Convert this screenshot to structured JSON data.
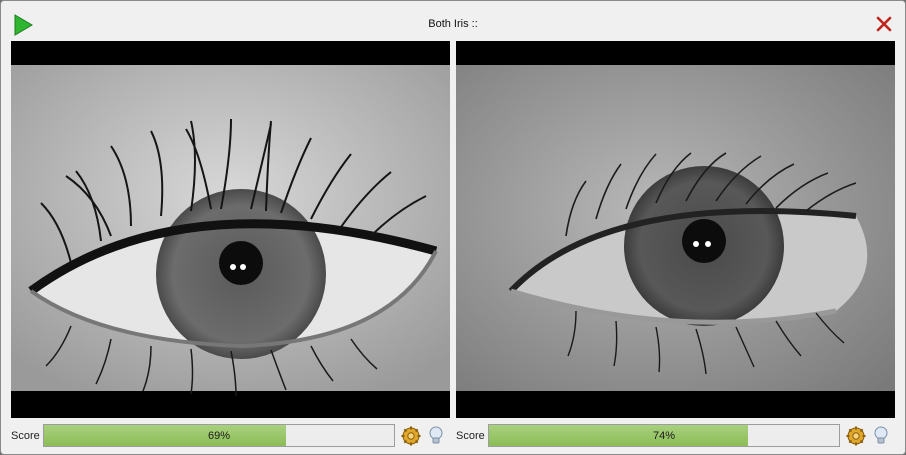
{
  "window": {
    "title": "Both Iris ::",
    "play_icon": "play-icon",
    "close_icon": "close-icon"
  },
  "panels": [
    {
      "eye": "left",
      "score_label": "Score",
      "score_value": 0.69,
      "score_text": "69%",
      "gear_icon": "gear-icon",
      "bulb_icon": "lightbulb-icon"
    },
    {
      "eye": "right",
      "score_label": "Score",
      "score_value": 0.74,
      "score_text": "74%",
      "gear_icon": "gear-icon",
      "bulb_icon": "lightbulb-icon"
    }
  ],
  "colors": {
    "progress_fill": "#8bbd56",
    "play": "#2fb52f",
    "close": "#c0241c"
  }
}
